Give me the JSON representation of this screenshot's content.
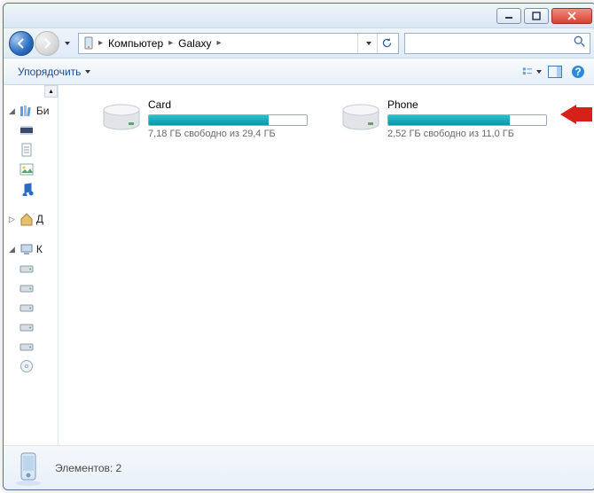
{
  "breadcrumb": {
    "root_icon": "device",
    "items": [
      "Компьютер",
      "Galaxy"
    ]
  },
  "toolbar": {
    "organize": "Упорядочить"
  },
  "sidebar": {
    "groups": [
      {
        "label": "Би",
        "icon": "library",
        "items": [
          {
            "label": "",
            "icon": "video"
          },
          {
            "label": "",
            "icon": "doc"
          },
          {
            "label": "",
            "icon": "picture"
          },
          {
            "label": "",
            "icon": "music"
          }
        ]
      },
      {
        "label": "Д",
        "icon": "home",
        "items": []
      },
      {
        "label": "К",
        "icon": "computer",
        "items": [
          {
            "label": "",
            "icon": "drive"
          },
          {
            "label": "",
            "icon": "drive"
          },
          {
            "label": "",
            "icon": "drive"
          },
          {
            "label": "",
            "icon": "drive"
          },
          {
            "label": "",
            "icon": "drive"
          },
          {
            "label": "",
            "icon": "cd"
          }
        ]
      }
    ]
  },
  "drives": [
    {
      "name": "Card",
      "fill_percent": 76,
      "free_text": "7,18 ГБ свободно из 29,4 ГБ"
    },
    {
      "name": "Phone",
      "fill_percent": 77,
      "free_text": "2,52 ГБ свободно из 11,0 ГБ"
    }
  ],
  "status": {
    "count_text": "Элементов: 2"
  },
  "search": {
    "placeholder": ""
  }
}
